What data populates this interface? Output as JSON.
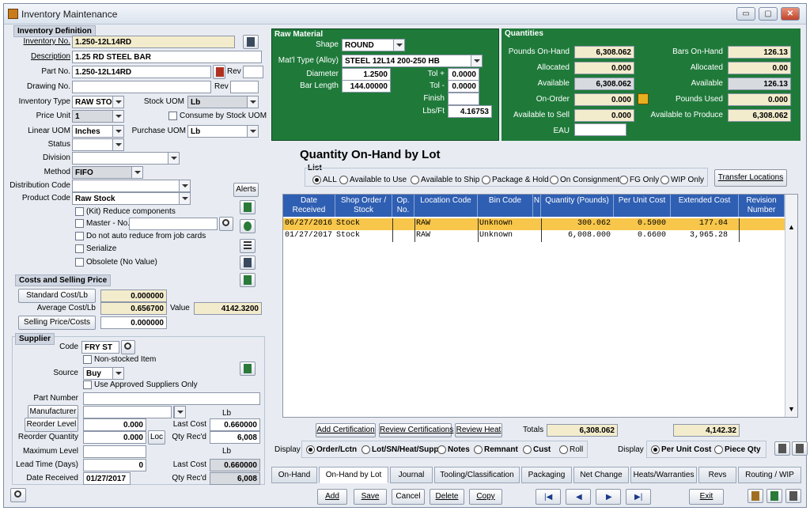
{
  "window": {
    "title": "Inventory Maintenance",
    "min": "▭",
    "max": "▢",
    "close": "✕"
  },
  "inv_def": {
    "header": "Inventory Definition",
    "inventory_no_label": "Inventory No.",
    "inventory_no": "1.250-12L14RD",
    "description_label": "Description",
    "description": "1.25 RD STEEL BAR",
    "part_no_label": "Part No.",
    "part_no": "1.250-12L14RD",
    "rev_label": "Rev",
    "drawing_no_label": "Drawing No.",
    "drawing_rev_label": "Rev",
    "inventory_type_label": "Inventory Type",
    "inventory_type": "RAW STOC",
    "stock_uom_label": "Stock UOM",
    "stock_uom": "Lb",
    "price_unit_label": "Price Unit",
    "price_unit": "1",
    "consume_label": "Consume by Stock UOM",
    "linear_uom_label": "Linear UOM",
    "linear_uom": "Inches",
    "purchase_uom_label": "Purchase UOM",
    "purchase_uom": "Lb",
    "status_label": "Status",
    "division_label": "Division",
    "method_label": "Method",
    "method": "FIFO",
    "distribution_label": "Distribution Code",
    "product_code_label": "Product Code",
    "product_code": "Raw Stock",
    "alerts_label": "Alerts",
    "kit_label": "(Kit) Reduce components",
    "master_label": "Master - No.",
    "no_auto_label": "Do not auto reduce from job cards",
    "serialize_label": "Serialize",
    "obsolete_label": "Obsolete (No Value)"
  },
  "costs": {
    "header": "Costs and Selling Price",
    "standard_label": "Standard Cost/Lb",
    "standard": "0.000000",
    "average_label": "Average Cost/Lb",
    "average": "0.656700",
    "value_label": "Value",
    "value": "4142.3200",
    "selling_label": "Selling Price/Costs",
    "selling": "0.000000"
  },
  "supplier": {
    "header": "Supplier",
    "code_label": "Code",
    "code": "FRY ST",
    "non_stocked_label": "Non-stocked Item",
    "source_label": "Source",
    "source": "Buy",
    "approved_label": "Use Approved Suppliers Only",
    "part_number_label": "Part Number",
    "manufacturer_label": "Manufacturer",
    "lb1": "Lb",
    "reorder_level_label": "Reorder Level",
    "reorder_level": "0.000",
    "last_cost_label": "Last Cost",
    "last_cost": "0.660000",
    "reorder_qty_label": "Reorder Quantity",
    "reorder_qty": "0.000",
    "loc_label": "Loc",
    "qty_recd_label": "Qty Rec'd",
    "qty_recd": "6,008",
    "max_level_label": "Maximum Level",
    "lb2": "Lb",
    "lead_time_label": "Lead Time (Days)",
    "lead_time": "0",
    "last_cost2_label": "Last Cost",
    "last_cost2": "0.660000",
    "date_received_label": "Date Received",
    "date_received": "01/27/2017",
    "qty_recd2_label": "Qty Rec'd",
    "qty_recd2": "6,008"
  },
  "raw_material": {
    "header": "Raw Material",
    "shape_label": "Shape",
    "shape": "ROUND",
    "mat_type_label": "Mat'l Type (Alloy)",
    "mat_type": "STEEL 12L14  200-250 HB",
    "diameter_label": "Diameter",
    "diameter": "1.2500",
    "tol_plus_label": "Tol +",
    "tol_plus": "0.0000",
    "bar_length_label": "Bar Length",
    "bar_length": "144.00000",
    "tol_minus_label": "Tol -",
    "tol_minus": "0.0000",
    "finish_label": "Finish",
    "lbs_ft_label": "Lbs/Ft",
    "lbs_ft": "4.16753"
  },
  "quantities": {
    "header": "Quantities",
    "pounds_onhand_label": "Pounds On-Hand",
    "pounds_onhand": "6,308.062",
    "bars_onhand_label": "Bars On-Hand",
    "bars_onhand": "126.13",
    "allocated_label": "Allocated",
    "allocated": "0.000",
    "allocated2_label": "Allocated",
    "allocated2": "0.00",
    "available_label": "Available",
    "available": "6,308.062",
    "available2_label": "Available",
    "available2": "126.13",
    "on_order_label": "On-Order",
    "on_order": "0.000",
    "pounds_used_label": "Pounds Used",
    "pounds_used": "0.000",
    "avail_sell_label": "Available to Sell",
    "avail_sell": "0.000",
    "avail_produce_label": "Available to Produce",
    "avail_produce": "6,308.062",
    "eau_label": "EAU"
  },
  "lot": {
    "title": "Quantity On-Hand by Lot",
    "list_label": "List",
    "filters": [
      "ALL",
      "Available to Use",
      "Available to Ship",
      "Package & Hold",
      "On Consignment",
      "FG Only",
      "WIP Only"
    ],
    "transfer_label": "Transfer Locations",
    "columns": [
      "Date Received",
      "Shop Order / Stock",
      "Op. No.",
      "Location Code",
      "Bin Code",
      "N",
      "Quantity (Pounds)",
      "Per Unit Cost",
      "Extended Cost",
      "Revision Number"
    ],
    "rows": [
      {
        "date": "06/27/2016",
        "shop": "Stock",
        "op": "",
        "loc": "RAW",
        "bin": "Unknown",
        "qty": "300.062",
        "unit": "0.5900",
        "ext": "177.04",
        "rev": ""
      },
      {
        "date": "01/27/2017",
        "shop": "Stock",
        "op": "",
        "loc": "RAW",
        "bin": "Unknown",
        "qty": "6,008.000",
        "unit": "0.6600",
        "ext": "3,965.28",
        "rev": ""
      }
    ],
    "add_cert": "Add Certification",
    "review_cert": "Review Certifications",
    "review_heat": "Review Heat",
    "totals_label": "Totals",
    "totals_qty": "6,308.062",
    "totals_ext": "4,142.32",
    "display_label": "Display",
    "display_opts": [
      "Order/Lctn",
      "Lot/SN/Heat/Supp",
      "Notes",
      "Remnant",
      "Cust",
      "Roll"
    ],
    "display2_label": "Display",
    "display2_opts": [
      "Per Unit Cost",
      "Piece Qty"
    ]
  },
  "tabs": [
    "On-Hand",
    "On-Hand by Lot",
    "Journal",
    "Tooling/Classification",
    "Packaging",
    "Net Change",
    "Heats/Warranties",
    "Revs",
    "Routing / WIP"
  ],
  "bottom": {
    "add": "Add",
    "save": "Save",
    "cancel": "Cancel",
    "delete": "Delete",
    "copy": "Copy",
    "exit": "Exit"
  },
  "colors": {
    "accent": "#2f5fb3",
    "raw_panel": "#1f7a3a",
    "selected_row": "#f7c64a"
  }
}
